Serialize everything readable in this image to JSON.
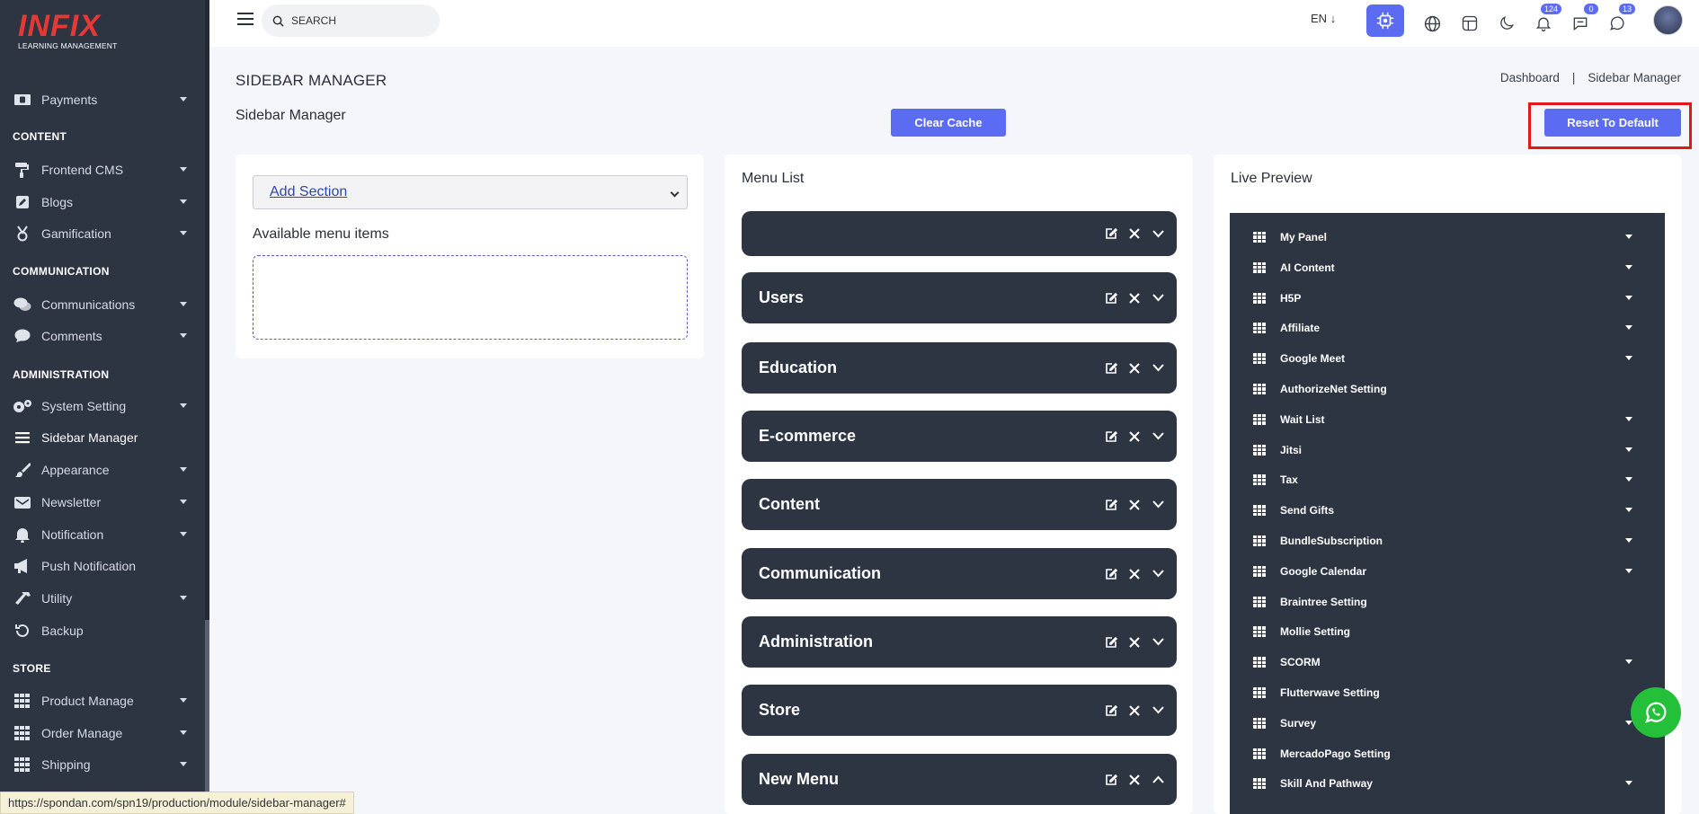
{
  "sidebar": {
    "logo_text": "INFIX",
    "logo_tagline": "LEARNING MANAGEMENT",
    "groups": [
      {
        "heading": "",
        "items": [
          {
            "label": "Payments",
            "icon": "money-icon",
            "caret": true
          }
        ]
      },
      {
        "heading": "CONTENT",
        "items": [
          {
            "label": "Frontend CMS",
            "icon": "paint-roller-icon",
            "caret": true
          },
          {
            "label": "Blogs",
            "icon": "edit-icon",
            "caret": true
          },
          {
            "label": "Gamification",
            "icon": "medal-icon",
            "caret": true
          }
        ]
      },
      {
        "heading": "COMMUNICATION",
        "items": [
          {
            "label": "Communications",
            "icon": "chat-bubbles-icon",
            "caret": true
          },
          {
            "label": "Comments",
            "icon": "comment-icon",
            "caret": true
          }
        ]
      },
      {
        "heading": "ADMINISTRATION",
        "items": [
          {
            "label": "System Setting",
            "icon": "gears-icon",
            "caret": true
          },
          {
            "label": "Sidebar Manager",
            "icon": "bars-icon",
            "caret": false,
            "active": true
          },
          {
            "label": "Appearance",
            "icon": "brush-icon",
            "caret": true
          },
          {
            "label": "Newsletter",
            "icon": "envelope-icon",
            "caret": true
          },
          {
            "label": "Notification",
            "icon": "bell-icon",
            "caret": true
          },
          {
            "label": "Push Notification",
            "icon": "megaphone-icon",
            "caret": false
          },
          {
            "label": "Utility",
            "icon": "hammer-icon",
            "caret": true
          },
          {
            "label": "Backup",
            "icon": "backup-icon",
            "caret": false
          }
        ]
      },
      {
        "heading": "STORE",
        "items": [
          {
            "label": "Product Manage",
            "icon": "grid-icon",
            "caret": true
          },
          {
            "label": "Order Manage",
            "icon": "grid-icon",
            "caret": true
          },
          {
            "label": "Shipping",
            "icon": "grid-icon",
            "caret": true
          }
        ]
      }
    ]
  },
  "topbar": {
    "search_placeholder": "SEARCH",
    "language": "EN",
    "badges": {
      "notifications": "124",
      "messages": "0",
      "chats": "13"
    }
  },
  "page": {
    "title": "SIDEBAR MANAGER",
    "breadcrumb": [
      "Dashboard",
      "Sidebar Manager"
    ],
    "subtitle": "Sidebar Manager",
    "clear_cache_label": "Clear Cache",
    "reset_label": "Reset To Default"
  },
  "sections_panel": {
    "select_value": "Add Section",
    "available_label": "Available menu items"
  },
  "menu_list": {
    "title": "Menu List",
    "items": [
      "",
      "Users",
      "Education",
      "E-commerce",
      "Content",
      "Communication",
      "Administration",
      "Store",
      "New Menu"
    ]
  },
  "live_preview": {
    "title": "Live Preview",
    "items": [
      {
        "label": "My Panel",
        "caret": true
      },
      {
        "label": "AI Content",
        "caret": true
      },
      {
        "label": "H5P",
        "caret": true
      },
      {
        "label": "Affiliate",
        "caret": true
      },
      {
        "label": "Google Meet",
        "caret": true
      },
      {
        "label": "AuthorizeNet Setting",
        "caret": false
      },
      {
        "label": "Wait List",
        "caret": true
      },
      {
        "label": "Jitsi",
        "caret": true
      },
      {
        "label": "Tax",
        "caret": true
      },
      {
        "label": "Send Gifts",
        "caret": true
      },
      {
        "label": "BundleSubscription",
        "caret": true
      },
      {
        "label": "Google Calendar",
        "caret": true
      },
      {
        "label": "Braintree Setting",
        "caret": false
      },
      {
        "label": "Mollie Setting",
        "caret": false
      },
      {
        "label": "SCORM",
        "caret": true
      },
      {
        "label": "Flutterwave Setting",
        "caret": false
      },
      {
        "label": "Survey",
        "caret": true
      },
      {
        "label": "MercadoPago Setting",
        "caret": false
      },
      {
        "label": "Skill And Pathway",
        "caret": true
      }
    ]
  },
  "status_url": "https://spondan.com/spn19/production/module/sidebar-manager#",
  "colors": {
    "primary": "#5b6cf2",
    "sidebar": "#2d3442",
    "highlight": "#e01818",
    "whatsapp": "#25c03a"
  }
}
